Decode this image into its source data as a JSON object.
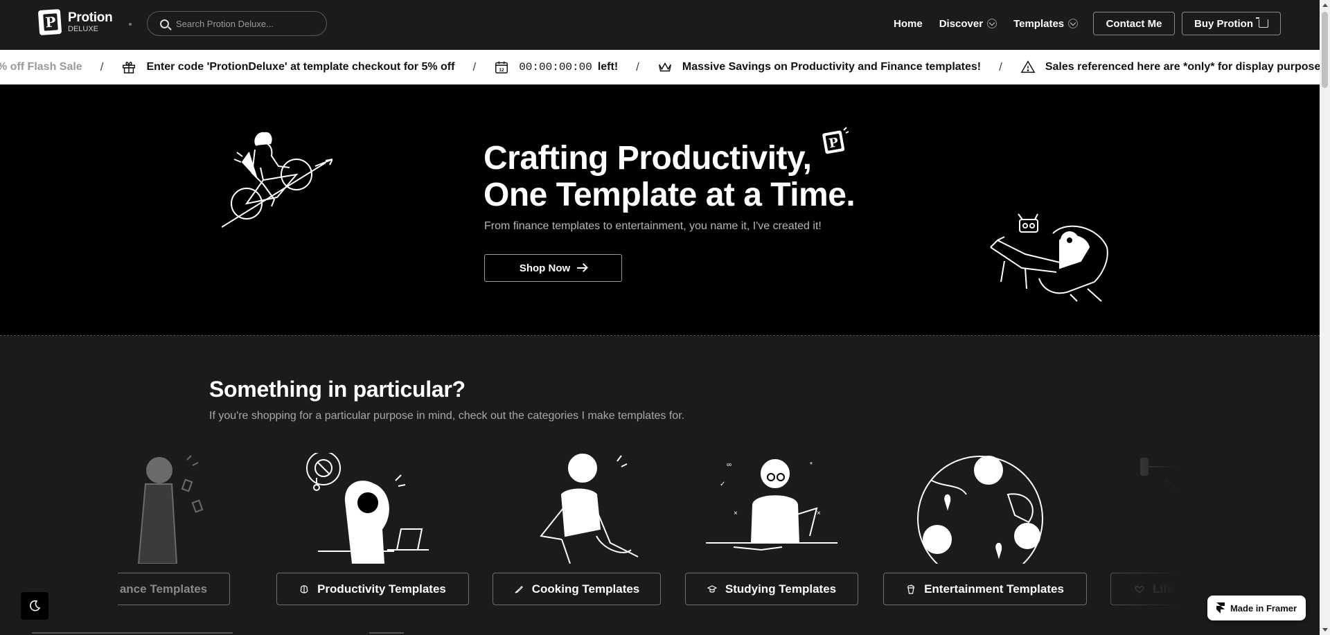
{
  "nav": {
    "logo_name": "Protion",
    "logo_sub": "DELUXE",
    "search_placeholder": "Search Protion Deluxe...",
    "links": [
      "Home",
      "Discover",
      "Templates"
    ],
    "contact_label": "Contact Me",
    "buy_label": "Buy Protion"
  },
  "ticker": {
    "flash_sale": "% off Flash Sale",
    "code_text": "Enter code 'ProtionDeluxe' at template checkout for 5% off",
    "timer": "00:00:00:00",
    "timer_suffix": "left!",
    "savings_text": "Massive Savings on Productivity and Finance templates!",
    "disclaimer": "Sales referenced here are *only* for display purposes - there is n",
    "separator": "/",
    "calendar_day": "12"
  },
  "hero": {
    "title_line1": "Crafting Productivity,",
    "title_line2": "One Template at a Time.",
    "subtitle": "From finance templates to entertainment, you name it, I've created it!",
    "cta_label": "Shop Now"
  },
  "categories": {
    "title": "Something in particular?",
    "subtitle": "If you're shopping for a particular purpose in mind, check out the categories I make templates for.",
    "items": [
      {
        "label": "ance Templates",
        "icon": "finance-icon"
      },
      {
        "label": "Productivity Templates",
        "icon": "brain-icon"
      },
      {
        "label": "Cooking Templates",
        "icon": "knife-icon"
      },
      {
        "label": "Studying Templates",
        "icon": "graduation-cap-icon"
      },
      {
        "label": "Entertainment Templates",
        "icon": "popcorn-icon"
      },
      {
        "label": "Life",
        "icon": "heart-icon"
      }
    ]
  },
  "footer": {
    "framer_label": "Made in Framer"
  },
  "colors": {
    "background": "#1b1b1b",
    "hero_background": "#000000",
    "ticker_background": "#ffffff",
    "text": "#ffffff",
    "muted_text": "#a8a8a8"
  }
}
